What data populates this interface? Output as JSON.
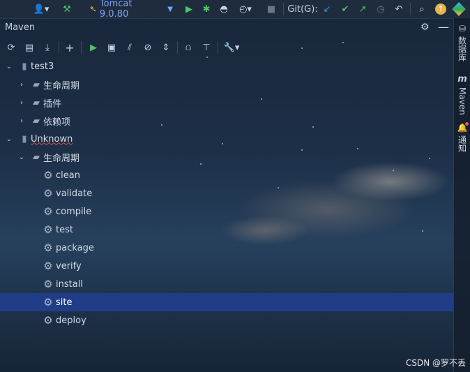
{
  "toolbar": {
    "run_config_label": "Tomcat 9.0.80",
    "git_label": "Git(G):",
    "icons": [
      "user-icon",
      "hammer-icon",
      "tomcat-icon",
      "run-icon",
      "debug-icon",
      "coverage-icon",
      "profile-icon",
      "stop-icon",
      "git-update-icon",
      "git-commit-icon",
      "git-push-icon",
      "history-icon",
      "rollback-icon",
      "search-icon",
      "update-icon",
      "toolbox-icon"
    ]
  },
  "tool_window": {
    "title": "Maven"
  },
  "right_stripe": {
    "items": [
      {
        "label": "数据库",
        "icon": "database-icon"
      },
      {
        "label": "Maven",
        "icon": "maven-icon"
      },
      {
        "label": "通知",
        "icon": "notification-icon"
      }
    ]
  },
  "tree": {
    "projects": [
      {
        "name": "test3",
        "expanded": true,
        "children": [
          {
            "label": "生命周期",
            "expanded": false
          },
          {
            "label": "插件",
            "expanded": false
          },
          {
            "label": "依赖项",
            "expanded": false
          }
        ]
      },
      {
        "name": "Unknown",
        "expanded": true,
        "children": [
          {
            "label": "生命周期",
            "expanded": true,
            "goals": [
              "clean",
              "validate",
              "compile",
              "test",
              "package",
              "verify",
              "install",
              "site",
              "deploy"
            ],
            "selected": "site"
          }
        ]
      }
    ]
  },
  "watermark": "CSDN @罗不丢",
  "colors": {
    "selection": "#21429c",
    "run_green": "#4fc26b",
    "accent_blue": "#3c8fd6"
  }
}
